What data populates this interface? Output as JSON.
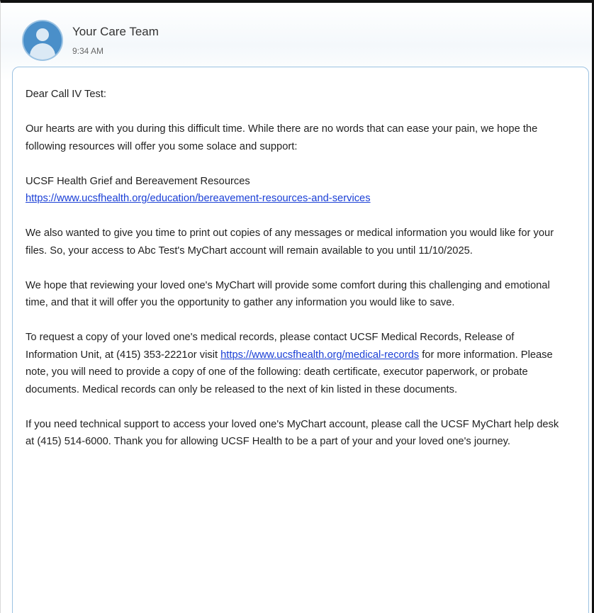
{
  "header": {
    "sender_name": "Your Care Team",
    "time": "9:34 AM",
    "avatar_icon": "person-icon"
  },
  "colors": {
    "link": "#1a3fd6",
    "bubble_border": "#9cc2e2",
    "avatar": "#4a8fc9"
  },
  "message": {
    "greeting": "Dear Call IV Test:",
    "p1": "Our hearts are with you during this difficult time. While there are no words that can ease your pain, we hope the following resources will offer you some solace and support:",
    "resource_title": "UCSF Health Grief and Bereavement Resources",
    "resource_link": "https://www.ucsfhealth.org/education/bereavement-resources-and-services",
    "p2": "We also wanted to give you time to print out copies of any messages or medical information you would like for your files. So, your access to Abc Test's MyChart account will remain available to you until 11/10/2025.",
    "p3": "We hope that reviewing your loved one's MyChart will provide some comfort during this challenging and emotional time, and that it will offer you the opportunity to gather any information you would like to save.",
    "p4_before_link": "To request a copy of your loved one's medical records, please contact UCSF Medical Records, Release of Information Unit, at (415) 353-2221or visit ",
    "p4_link": "https://www.ucsfhealth.org/medical-records",
    "p4_after_link": " for more information. Please note, you will need to provide a copy of one of the following: death certificate, executor paperwork, or probate documents. Medical records can only be released to the next of kin listed in these documents.",
    "p5": "If you need technical support to access your loved one's MyChart account, please call the UCSF MyChart help desk at (415) 514-6000. Thank you for allowing UCSF Health to be a part of your and your loved one's journey."
  }
}
